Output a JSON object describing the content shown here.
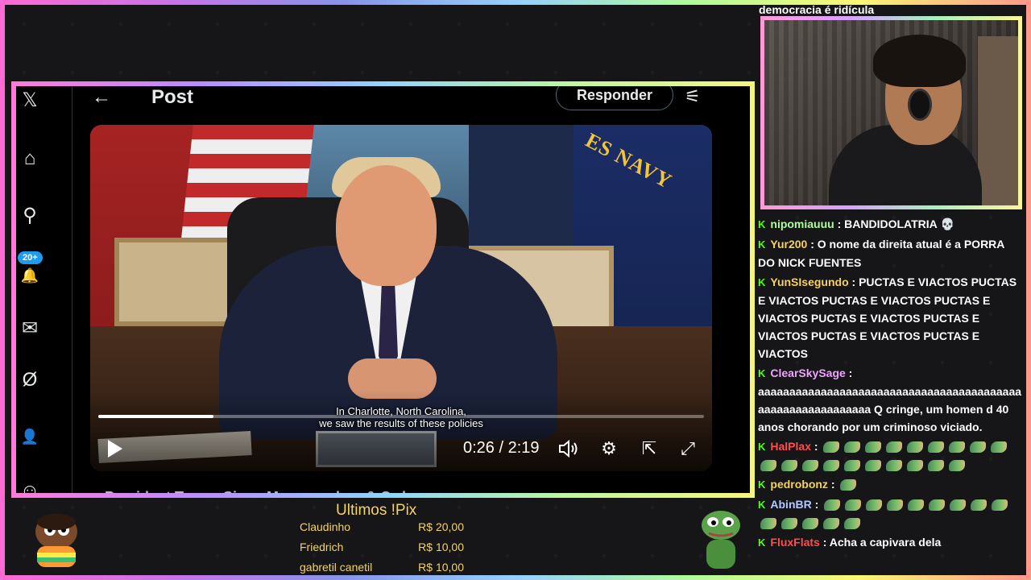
{
  "post": {
    "back_label": "←",
    "title": "Post",
    "reply_label": "Responder",
    "filter_icon": "⚟",
    "rail_badge": "20+",
    "below_title": "President Trump Signs Memorandum & Orders"
  },
  "video": {
    "caption_line1": "In Charlotte, North Carolina,",
    "caption_line2": "we saw the results of these policies",
    "time": "0:26 / 2:19",
    "progress": 0.19,
    "navy_text": "ES NAVY"
  },
  "chat": {
    "top_line": "democracia é ridícula",
    "messages": [
      {
        "user": "nipomiauuu",
        "color": "#aefc9c",
        "text": "BANDIDOLATRIA",
        "skull": "💀",
        "emotes": 0
      },
      {
        "user": "Yur200",
        "color": "#f7d15c",
        "text": "O nome da direita atual é a PORRA DO NICK FUENTES",
        "emotes": 0
      },
      {
        "user": "YunSIsegundo",
        "color": "#f7d15c",
        "text": "PUCTAS E VIACTOS PUCTAS E VIACTOS PUCTAS E VIACTOS PUCTAS E VIACTOS PUCTAS E VIACTOS PUCTAS E VIACTOS PUCTAS E VIACTOS PUCTAS E VIACTOS",
        "emotes": 0
      },
      {
        "user": "ClearSkySage",
        "color": "#f1a2ff",
        "text": "aaaaaaaaaaaaaaaaaaaaaaaaaaaaaaaaaaaaaaaaaaaaaaaaaaaaaaaaaaaa Q cringe, um homen d 40 anos chorando por um criminoso viciado.",
        "emotes": 0
      },
      {
        "user": "HalPlax",
        "color": "#ff4d4d",
        "text": "",
        "emotes": 19
      },
      {
        "user": "pedrobonz",
        "color": "#f7d15c",
        "text": "",
        "emotes": 1
      },
      {
        "user": "AbinBR",
        "color": "#b7c7ff",
        "text": "",
        "emotes": 14
      },
      {
        "user": "FluxFlats",
        "color": "#ff4d4d",
        "text": "Acha a capivara dela",
        "emotes": 0
      }
    ]
  },
  "pix": {
    "title": "Ultimos !Pix",
    "rows": [
      {
        "name": "Claudinho",
        "value": "R$ 20,00"
      },
      {
        "name": "Friedrich",
        "value": "R$ 10,00"
      },
      {
        "name": "gabretil canetil",
        "value": "R$ 10,00"
      }
    ]
  },
  "icons": {
    "x_logo": "𝕏",
    "home": "⌂",
    "search": "⚲",
    "notifications": "🔔",
    "messages": "✉",
    "grok": "Ø",
    "profile": "👤",
    "more": "☺",
    "play": "▶",
    "volume": "🔊",
    "settings": "⚙",
    "popout": "⇱",
    "fullscreen": "⤢"
  },
  "colors": {
    "accent_x": "#1d9bf0",
    "kick_green": "#53fc18",
    "pix_gold": "#f4d35e"
  }
}
